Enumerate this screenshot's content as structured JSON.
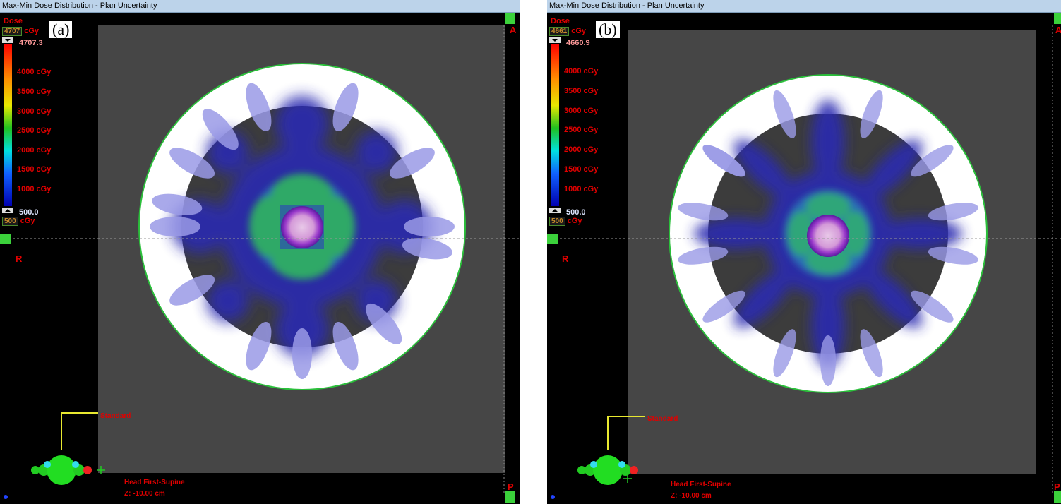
{
  "panels": [
    {
      "id": "a",
      "window_title": "Max-Min Dose Distribution - Plan Uncertainty",
      "caption": "(a)",
      "dose_label": "Dose",
      "dose_max_box": "4707",
      "dose_unit": "cGy",
      "colorbar_max": "4707.3",
      "colorbar_min": "500.0",
      "dose_min_box": "500",
      "colorbar_ticks": [
        "4000 cGy",
        "3500 cGy",
        "3000 cGy",
        "2500 cGy",
        "2000 cGy",
        "1500 cGy",
        "1000 cGy"
      ],
      "orientation": {
        "anterior": "A",
        "right": "R",
        "posterior": "P"
      },
      "view_label": "Standard",
      "patient_position": "Head First-Supine",
      "z_position": "Z: -10.00 cm"
    },
    {
      "id": "b",
      "window_title": "Max-Min Dose Distribution - Plan Uncertainty",
      "caption": "(b)",
      "dose_label": "Dose",
      "dose_max_box": "4661",
      "dose_unit": "cGy",
      "colorbar_max": "4660.9",
      "colorbar_min": "500.0",
      "dose_min_box": "500",
      "colorbar_ticks": [
        "4000 cGy",
        "3500 cGy",
        "3000 cGy",
        "2500 cGy",
        "2000 cGy",
        "1500 cGy",
        "1000 cGy"
      ],
      "orientation": {
        "anterior": "A",
        "right": "R",
        "posterior": "P"
      },
      "view_label": "Standard",
      "patient_position": "Head First-Supine",
      "z_position": "Z: -10.00 cm"
    }
  ],
  "colors": {
    "background": "#000000",
    "image_field": "#464646",
    "phantom_outer": "#ffffff",
    "phantom_inner": "#3c3c3c",
    "contour": "#2bbf3b",
    "low_dose": "#2a2ab0",
    "beam_petal": "#9a9ae6",
    "mid_dose": "#2fb060",
    "high_dose": "#b86cd0",
    "label_red": "#e00000"
  }
}
